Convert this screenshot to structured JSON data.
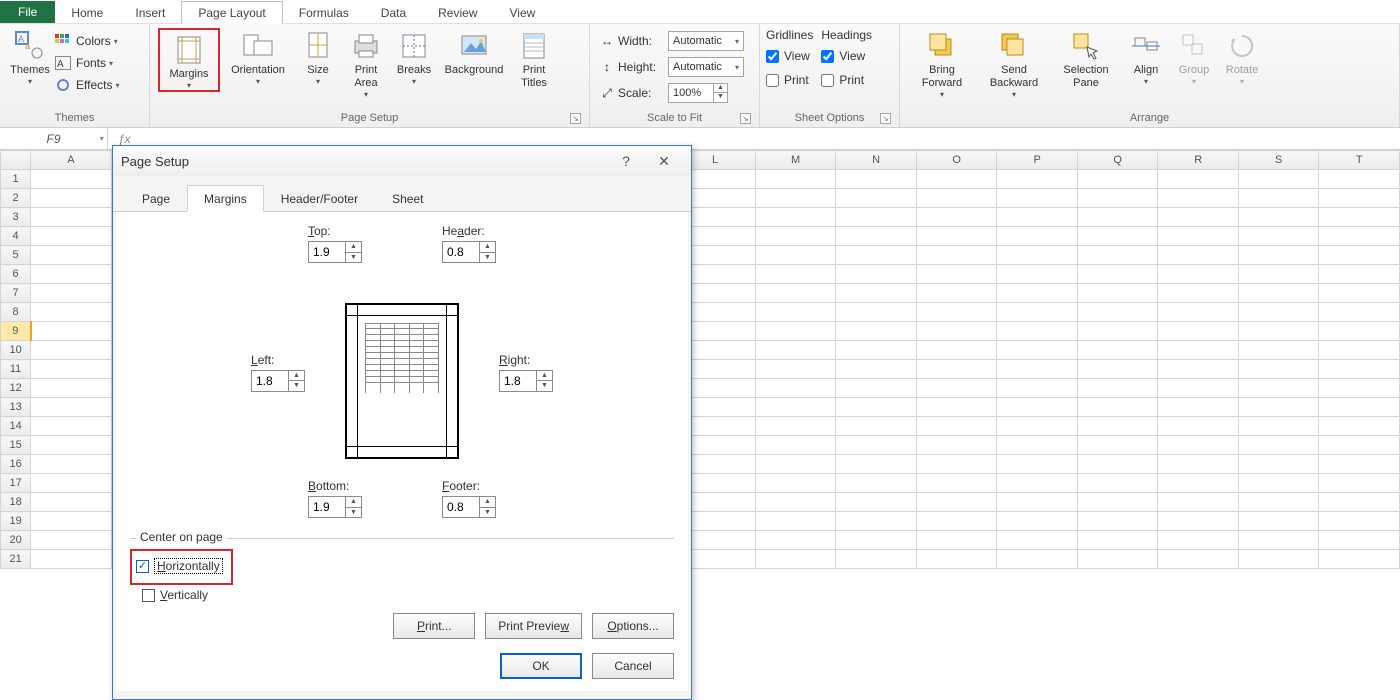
{
  "tabs": {
    "file": "File",
    "home": "Home",
    "insert": "Insert",
    "page_layout": "Page Layout",
    "formulas": "Formulas",
    "data": "Data",
    "review": "Review",
    "view": "View"
  },
  "themes": {
    "group": "Themes",
    "themes": "Themes",
    "colors": "Colors",
    "fonts": "Fonts",
    "effects": "Effects"
  },
  "page_setup": {
    "group": "Page Setup",
    "margins": "Margins",
    "orientation": "Orientation",
    "size": "Size",
    "print_area": "Print\nArea",
    "breaks": "Breaks",
    "background": "Background",
    "print_titles": "Print\nTitles"
  },
  "scale": {
    "group": "Scale to Fit",
    "width": "Width:",
    "height": "Height:",
    "scale": "Scale:",
    "width_val": "Automatic",
    "height_val": "Automatic",
    "scale_val": "100%"
  },
  "sheet_opts": {
    "group": "Sheet Options",
    "gridlines": "Gridlines",
    "headings": "Headings",
    "view": "View",
    "print": "Print"
  },
  "arrange": {
    "group": "Arrange",
    "bring_forward": "Bring\nForward",
    "send_backward": "Send\nBackward",
    "selection_pane": "Selection\nPane",
    "align": "Align",
    "group_btn": "Group",
    "rotate": "Rotate"
  },
  "namebox": "F9",
  "columns": [
    "A",
    "L",
    "M",
    "N",
    "O",
    "P",
    "Q",
    "R",
    "S",
    "T"
  ],
  "rows": [
    "1",
    "2",
    "3",
    "4",
    "5",
    "6",
    "7",
    "8",
    "9",
    "10",
    "11",
    "12",
    "13",
    "14",
    "15",
    "16",
    "17",
    "18",
    "19",
    "20",
    "21"
  ],
  "active_row": "9",
  "dialog": {
    "title": "Page Setup",
    "help": "?",
    "close": "✕",
    "tabs": {
      "page": "Page",
      "margins": "Margins",
      "hf": "Header/Footer",
      "sheet": "Sheet"
    },
    "top": "Top:",
    "header": "Header:",
    "left": "Left:",
    "right": "Right:",
    "bottom": "Bottom:",
    "footer": "Footer:",
    "top_val": "1.9",
    "header_val": "0.8",
    "left_val": "1.8",
    "right_val": "1.8",
    "bottom_val": "1.9",
    "footer_val": "0.8",
    "center_on_page": "Center on page",
    "horizontally": "Horizontally",
    "vertically": "Vertically",
    "print": "Print...",
    "print_preview": "Print Preview",
    "options": "Options...",
    "ok": "OK",
    "cancel": "Cancel"
  }
}
